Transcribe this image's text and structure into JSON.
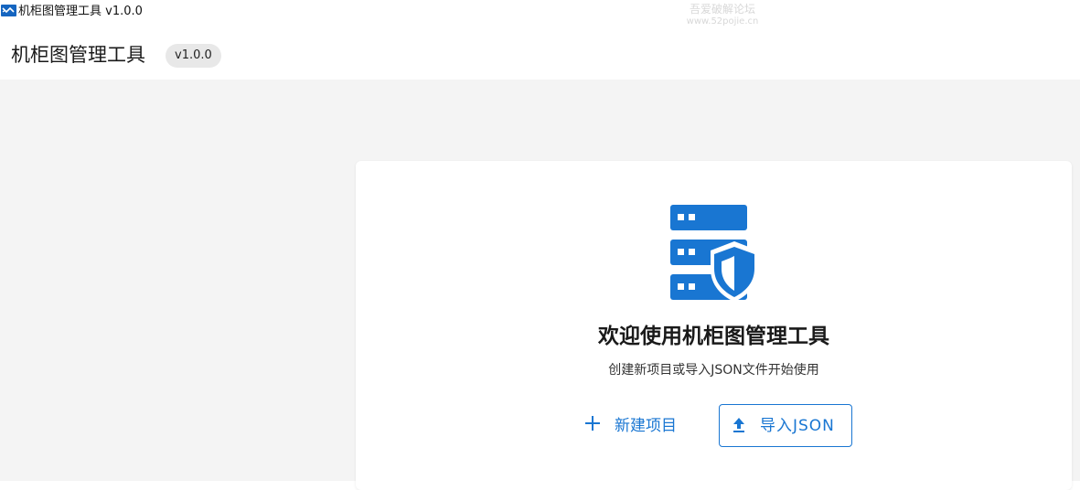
{
  "window": {
    "title": "机柜图管理工具 v1.0.0",
    "icon": "app-logo-icon"
  },
  "watermark": {
    "line1": "吾爱破解论坛",
    "line2": "www.52pojie.cn"
  },
  "header": {
    "title": "机柜图管理工具",
    "version": "v1.0.0"
  },
  "welcome": {
    "icon": "server-shield-icon",
    "title": "欢迎使用机柜图管理工具",
    "subtitle": "创建新项目或导入JSON文件开始使用",
    "new_project_label": "新建项目",
    "new_project_icon": "plus-icon",
    "import_label": "导入JSON",
    "import_icon": "upload-icon"
  },
  "colors": {
    "accent": "#1976d2",
    "background": "#f4f4f4",
    "badge_bg": "#e8e8e8"
  }
}
